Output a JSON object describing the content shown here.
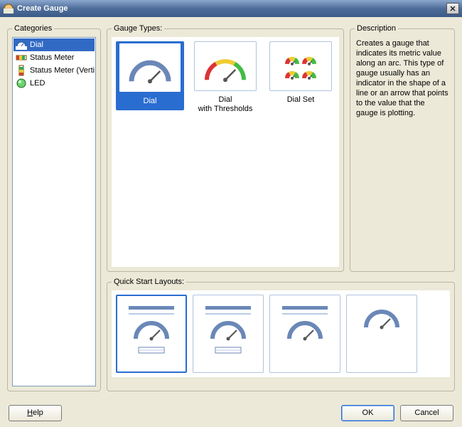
{
  "title": "Create Gauge",
  "categories": {
    "legend": "Categories",
    "items": [
      {
        "label": "Dial",
        "icon": "dial"
      },
      {
        "label": "Status Meter",
        "icon": "status"
      },
      {
        "label": "Status Meter (Verti...",
        "icon": "statusv"
      },
      {
        "label": "LED",
        "icon": "led"
      }
    ],
    "selected": 0
  },
  "types": {
    "legend": "Gauge Types:",
    "items": [
      {
        "label": "Dial",
        "variant": "dial"
      },
      {
        "label": "Dial\nwith Thresholds",
        "variant": "dial-thresh"
      },
      {
        "label": "Dial Set",
        "variant": "dial-set"
      }
    ],
    "selected": 0
  },
  "description": {
    "legend": "Description",
    "text": "Creates a gauge that indicates its metric value along an arc. This type of gauge usually has an indicator in the shape of a line or an arrow that points to the value that the gauge is plotting."
  },
  "layouts": {
    "legend": "Quick Start Layouts:",
    "count": 4,
    "selected": 0,
    "variants": [
      "title-legend-bottom",
      "title-legend-bottom2",
      "title-gauge",
      "gauge-only"
    ]
  },
  "buttons": {
    "help": "Help",
    "ok": "OK",
    "cancel": "Cancel"
  }
}
